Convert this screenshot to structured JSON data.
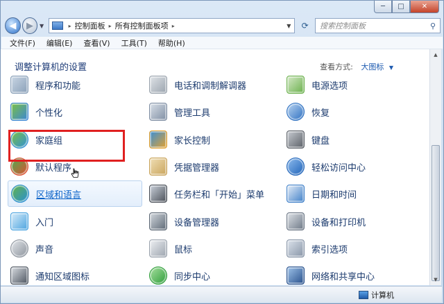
{
  "window": {
    "controls": {
      "minimize": "─",
      "maximize": "□",
      "close": "✕"
    }
  },
  "nav": {
    "back": "◀",
    "forward": "▶",
    "breadcrumbs": [
      "控制面板",
      "所有控制面板项"
    ],
    "search_placeholder": "搜索控制面板"
  },
  "menu": [
    "文件(F)",
    "编辑(E)",
    "查看(V)",
    "工具(T)",
    "帮助(H)"
  ],
  "content": {
    "heading": "调整计算机的设置",
    "view_by_label": "查看方式:",
    "view_by_value": "大图标"
  },
  "items": [
    {
      "label": "程序和功能",
      "icon": "programs-features-icon"
    },
    {
      "label": "电话和调制解调器",
      "icon": "phone-modem-icon"
    },
    {
      "label": "电源选项",
      "icon": "power-options-icon"
    },
    {
      "label": "个性化",
      "icon": "personalization-icon"
    },
    {
      "label": "管理工具",
      "icon": "admin-tools-icon"
    },
    {
      "label": "恢复",
      "icon": "recovery-icon"
    },
    {
      "label": "家庭组",
      "icon": "homegroup-icon"
    },
    {
      "label": "家长控制",
      "icon": "parental-controls-icon"
    },
    {
      "label": "键盘",
      "icon": "keyboard-icon"
    },
    {
      "label": "默认程序",
      "icon": "default-programs-icon"
    },
    {
      "label": "凭据管理器",
      "icon": "credential-manager-icon"
    },
    {
      "label": "轻松访问中心",
      "icon": "ease-of-access-icon"
    },
    {
      "label": "区域和语言",
      "icon": "region-language-icon"
    },
    {
      "label": "任务栏和「开始」菜单",
      "icon": "taskbar-start-icon"
    },
    {
      "label": "日期和时间",
      "icon": "date-time-icon"
    },
    {
      "label": "入门",
      "icon": "getting-started-icon"
    },
    {
      "label": "设备管理器",
      "icon": "device-manager-icon"
    },
    {
      "label": "设备和打印机",
      "icon": "devices-printers-icon"
    },
    {
      "label": "声音",
      "icon": "sound-icon"
    },
    {
      "label": "鼠标",
      "icon": "mouse-icon"
    },
    {
      "label": "索引选项",
      "icon": "indexing-options-icon"
    },
    {
      "label": "通知区域图标",
      "icon": "notification-area-icon"
    },
    {
      "label": "同步中心",
      "icon": "sync-center-icon"
    },
    {
      "label": "网络和共享中心",
      "icon": "network-sharing-icon"
    }
  ],
  "status": {
    "computer": "计算机"
  },
  "colors": {
    "accent": "#1e5bb0",
    "highlight_box": "#e02020",
    "hover_link": "#0d64c9"
  }
}
